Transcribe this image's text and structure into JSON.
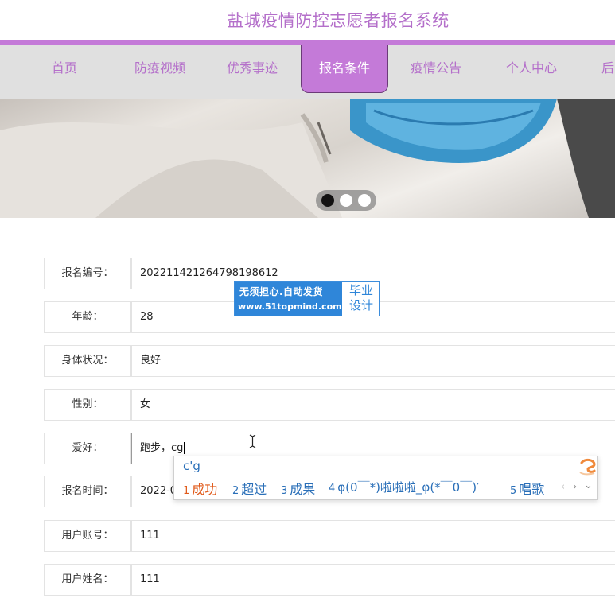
{
  "header": {
    "title": "盐城疫情防控志愿者报名系统"
  },
  "nav": {
    "items": [
      {
        "label": "首页"
      },
      {
        "label": "防疫视频"
      },
      {
        "label": "优秀事迹"
      },
      {
        "label": "报名条件"
      },
      {
        "label": "疫情公告"
      },
      {
        "label": "个人中心"
      },
      {
        "label": "后"
      }
    ],
    "active_index": 3
  },
  "banner": {
    "dots": 3,
    "active_dot": 0
  },
  "form": {
    "rows": [
      {
        "label": "报名编号：",
        "value": "20221142126479819861​2"
      },
      {
        "label": "年龄：",
        "value": "28"
      },
      {
        "label": "身体状况：",
        "value": "良好"
      },
      {
        "label": "性别：",
        "value": "女"
      },
      {
        "label": "爱好：",
        "value": "跑步，",
        "composing": "cg"
      },
      {
        "label": "报名时间：",
        "value": "2022-0"
      },
      {
        "label": "用户账号：",
        "value": "111"
      },
      {
        "label": "用户姓名：",
        "value": "111"
      }
    ]
  },
  "watermark": {
    "slogan": "无须担心.自动发货",
    "url": "www.51topmind.com",
    "tag_line1": "毕业",
    "tag_line2": "设计"
  },
  "ime": {
    "composition": "c'g",
    "candidates": [
      {
        "num": "1",
        "text": "成功"
      },
      {
        "num": "2",
        "text": "超过"
      },
      {
        "num": "3",
        "text": "成果"
      },
      {
        "num": "4",
        "text": "φ(0￣*)啦啦啦_φ(*￣0￣)′"
      },
      {
        "num": "5",
        "text": "唱歌"
      }
    ],
    "prev_label": "‹",
    "next_label": "›",
    "expand_label": "⌄",
    "colors": {
      "candidate": "#2a6fb8",
      "selected": "#e05a1a",
      "logo": "#f08a3c"
    }
  },
  "theme": {
    "accent": "#c47ad8",
    "title": "#b46fca",
    "nav_bg": "#e0e0e0"
  }
}
